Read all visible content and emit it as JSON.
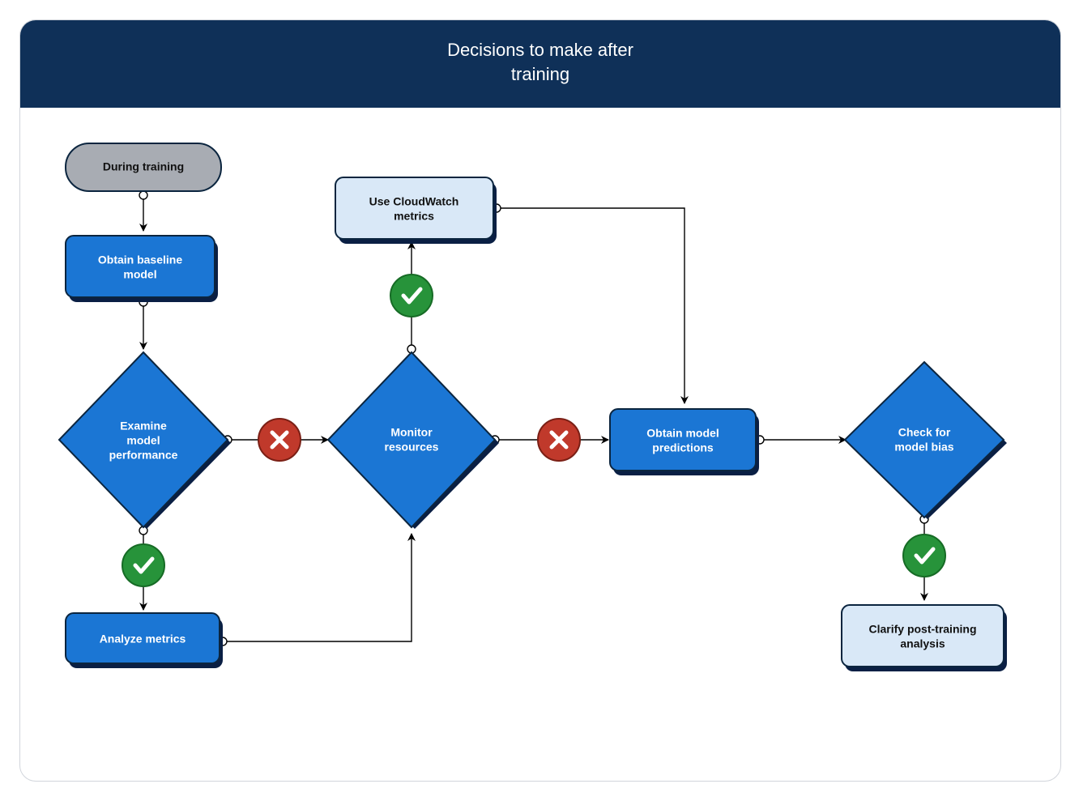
{
  "header": {
    "title_line1": "Decisions to make after",
    "title_line2": "training"
  },
  "nodes": {
    "during_training": "During training",
    "obtain_baseline_l1": "Obtain baseline",
    "obtain_baseline_l2": "model",
    "examine_l1": "Examine",
    "examine_l2": "model",
    "examine_l3": "performance",
    "analyze_metrics": "Analyze metrics",
    "cloudwatch_l1": "Use CloudWatch",
    "cloudwatch_l2": "metrics",
    "monitor_l1": "Monitor",
    "monitor_l2": "resources",
    "obtain_pred_l1": "Obtain model",
    "obtain_pred_l2": "predictions",
    "check_bias_l1": "Check for",
    "check_bias_l2": "model bias",
    "clarify_l1": "Clarify post-training",
    "clarify_l2": "analysis"
  },
  "icons": {
    "yes": "check-icon",
    "no": "cross-icon"
  },
  "chart_data": {
    "type": "flowchart",
    "title": "Decisions to make after training",
    "shapes": {
      "start": "rounded / pill",
      "process": "rectangle (blue = step, light-blue = outcome)",
      "decision": "diamond"
    },
    "nodes": [
      {
        "id": "during_training",
        "label": "During training",
        "shape": "start"
      },
      {
        "id": "obtain_baseline",
        "label": "Obtain baseline model",
        "shape": "process"
      },
      {
        "id": "examine_perf",
        "label": "Examine model performance",
        "shape": "decision"
      },
      {
        "id": "analyze_metrics",
        "label": "Analyze metrics",
        "shape": "process"
      },
      {
        "id": "monitor_resources",
        "label": "Monitor resources",
        "shape": "decision"
      },
      {
        "id": "use_cloudwatch",
        "label": "Use CloudWatch metrics",
        "shape": "process"
      },
      {
        "id": "obtain_predictions",
        "label": "Obtain model predictions",
        "shape": "process"
      },
      {
        "id": "check_bias",
        "label": "Check for model bias",
        "shape": "decision"
      },
      {
        "id": "clarify_analysis",
        "label": "Clarify post-training analysis",
        "shape": "process"
      }
    ],
    "edges": [
      {
        "from": "during_training",
        "to": "obtain_baseline",
        "label": null
      },
      {
        "from": "obtain_baseline",
        "to": "examine_perf",
        "label": null
      },
      {
        "from": "examine_perf",
        "to": "analyze_metrics",
        "label": "yes"
      },
      {
        "from": "examine_perf",
        "to": "monitor_resources",
        "label": "no"
      },
      {
        "from": "analyze_metrics",
        "to": "monitor_resources",
        "label": null
      },
      {
        "from": "monitor_resources",
        "to": "use_cloudwatch",
        "label": "yes"
      },
      {
        "from": "monitor_resources",
        "to": "obtain_predictions",
        "label": "no"
      },
      {
        "from": "use_cloudwatch",
        "to": "obtain_predictions",
        "label": null
      },
      {
        "from": "obtain_predictions",
        "to": "check_bias",
        "label": null
      },
      {
        "from": "check_bias",
        "to": "clarify_analysis",
        "label": "yes"
      }
    ]
  }
}
